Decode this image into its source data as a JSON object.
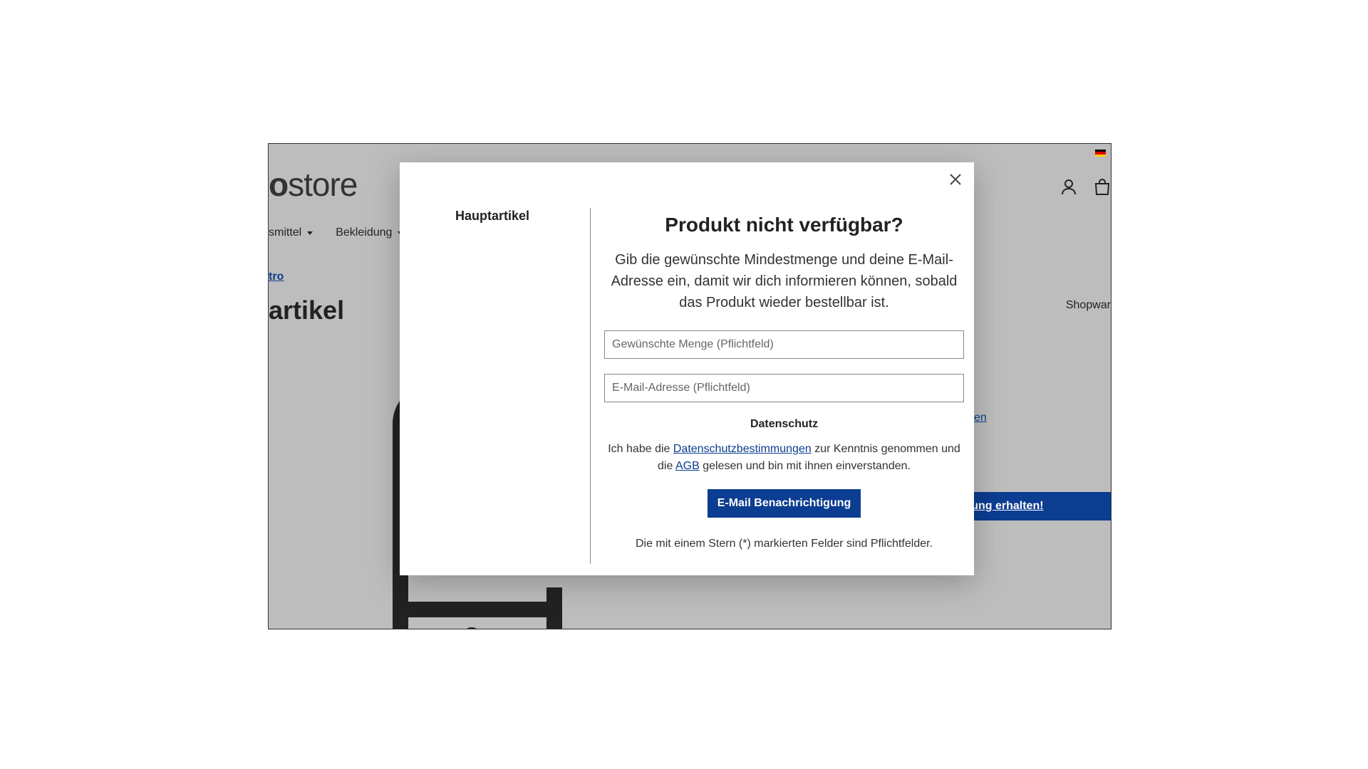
{
  "background_page": {
    "logo_bold": "o",
    "logo_rest": "store",
    "nav_items": [
      {
        "label": "smittel"
      },
      {
        "label": "Bekleidung"
      }
    ],
    "breadcrumb": "tro",
    "page_heading": "artikel",
    "manufacturer_label": "Shopwar",
    "side_link": "en",
    "notify_bar_label": "igung erhalten!"
  },
  "modal": {
    "left_title": "Hauptartikel",
    "title": "Produkt nicht verfügbar?",
    "description": "Gib die gewünschte Mindestmenge und deine E-Mail-Adresse ein, damit wir dich informieren können, sobald das Produkt wieder bestellbar ist.",
    "quantity_placeholder": "Gewünschte Menge (Pflichtfeld)",
    "email_placeholder": "E-Mail-Adresse (Pflichtfeld)",
    "privacy_title": "Datenschutz",
    "privacy_text_1": "Ich habe die ",
    "privacy_link": "Datenschutzbestimmungen",
    "privacy_text_2": " zur Kenntnis genommen und die ",
    "agb_link": "AGB",
    "privacy_text_3": " gelesen und bin mit ihnen einverstanden.",
    "submit_label": "E-Mail Benachrichtigung",
    "required_note": "Die mit einem Stern (*) markierten Felder sind Pflichtfelder."
  },
  "colors": {
    "accent": "#0b3d91",
    "overlay": "#bdbdbd"
  },
  "icons": [
    "close-icon",
    "user-icon",
    "shopping-bag-icon",
    "german-flag-icon",
    "chevron-down-icon"
  ]
}
